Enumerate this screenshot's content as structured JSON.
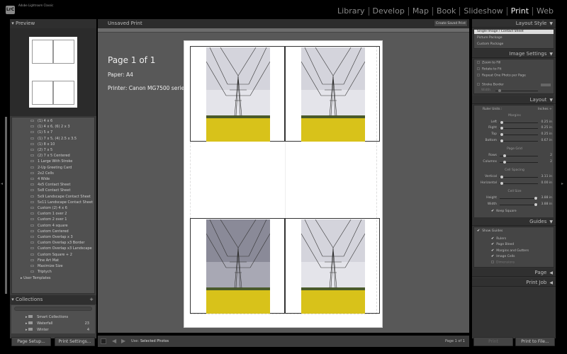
{
  "app": {
    "title": "Adobe Lightroom Classic",
    "logo": "LrC"
  },
  "modules": [
    "Library",
    "Develop",
    "Map",
    "Book",
    "Slideshow",
    "Print",
    "Web"
  ],
  "active_module": "Print",
  "left": {
    "preview_header": "Preview",
    "templates": [
      "(1) 4 x 6",
      "(1) 4 x 6, (6) 2 x 3",
      "(1) 5 x 7",
      "(1) 7 x 5, (4) 2.5 x 3.5",
      "(1) 8 x 10",
      "(2) 7 x 5",
      "(2) 7 x 5 Centered",
      "1 Large With Stroke",
      "2-Up Greeting Card",
      "2x2 Cells",
      "4 Wide",
      "4x5 Contact Sheet",
      "5x8 Contact Sheet",
      "5x9 Landscape Contact Sheet",
      "5x11 Landscape Contact Sheet",
      "Custom (2) 4 x 6",
      "Custom 1 over 2",
      "Custom 2 over 1",
      "Custom 4 square",
      "Custom Centered",
      "Custom Overlap x 3",
      "Custom Overlap x3 Border",
      "Custom Overlap x3 Landscape",
      "Custom Square + 2",
      "Fine Art Mat",
      "Maximize Size",
      "Triptych"
    ],
    "user_templates": "User Templates",
    "collections_header": "Collections",
    "collections": [
      {
        "name": "Smart Collections",
        "count": ""
      },
      {
        "name": "Waterfall",
        "count": "23"
      },
      {
        "name": "Winter",
        "count": "4"
      }
    ],
    "page_setup": "Page Setup...",
    "print_settings": "Print Settings..."
  },
  "center": {
    "title": "Unsaved Print",
    "create_saved": "Create Saved Print",
    "page_info": "Page 1 of 1",
    "paper": "Paper:  A4",
    "printer": "Printer:  Canon MG7500 series",
    "use_label": "Use:",
    "use_value": "Selected Photos",
    "page_count": "Page 1 of 1"
  },
  "right": {
    "layout_style": {
      "header": "Layout Style",
      "items": [
        "Single Image / Contact Sheet",
        "Picture Package",
        "Custom Package"
      ],
      "selected": 0
    },
    "image_settings": {
      "header": "Image Settings",
      "zoom": "Zoom to Fill",
      "rotate": "Rotate to Fit",
      "repeat": "Repeat One Photo per Page",
      "stroke": "Stroke Border",
      "width": "Width"
    },
    "layout": {
      "header": "Layout",
      "ruler_units": "Ruler Units :",
      "ruler_value": "Inches",
      "margins": "Margins",
      "page_grid": "Page Grid",
      "cell_spacing": "Cell Spacing",
      "cell_size": "Cell Size",
      "rows": [
        {
          "label": "Left",
          "value": "0.25 in",
          "pos": 0.02
        },
        {
          "label": "Right",
          "value": "0.25 in",
          "pos": 0.02
        },
        {
          "label": "Top",
          "value": "0.25 in",
          "pos": 0.02
        },
        {
          "label": "Bottom",
          "value": "0.67 in",
          "pos": 0.02
        },
        {
          "label": "Rows",
          "value": "2",
          "pos": 0.1
        },
        {
          "label": "Columns",
          "value": "2",
          "pos": 0.1
        },
        {
          "label": "Vertical",
          "value": "3.11 in",
          "pos": 0.02
        },
        {
          "label": "Horizontal",
          "value": "0.00 in",
          "pos": 0.02
        },
        {
          "label": "Height",
          "value": "3.88 in",
          "pos": 0.97
        },
        {
          "label": "Width",
          "value": "3.88 in",
          "pos": 0.97
        }
      ],
      "keep_square": "Keep Square"
    },
    "guides": {
      "header": "Guides",
      "show": "Show Guides",
      "items": [
        "Rulers",
        "Page Bleed",
        "Margins and Gutters",
        "Image Cells",
        "Dimensions"
      ],
      "checked": [
        true,
        true,
        true,
        true,
        false
      ]
    },
    "page_header": "Page",
    "print_job_header": "Print Job",
    "print": "Print",
    "print_to_file": "Print to File..."
  },
  "colors": {
    "field": "#d8c21a",
    "sky": "#c9c9d2",
    "canvas": "#585858"
  }
}
